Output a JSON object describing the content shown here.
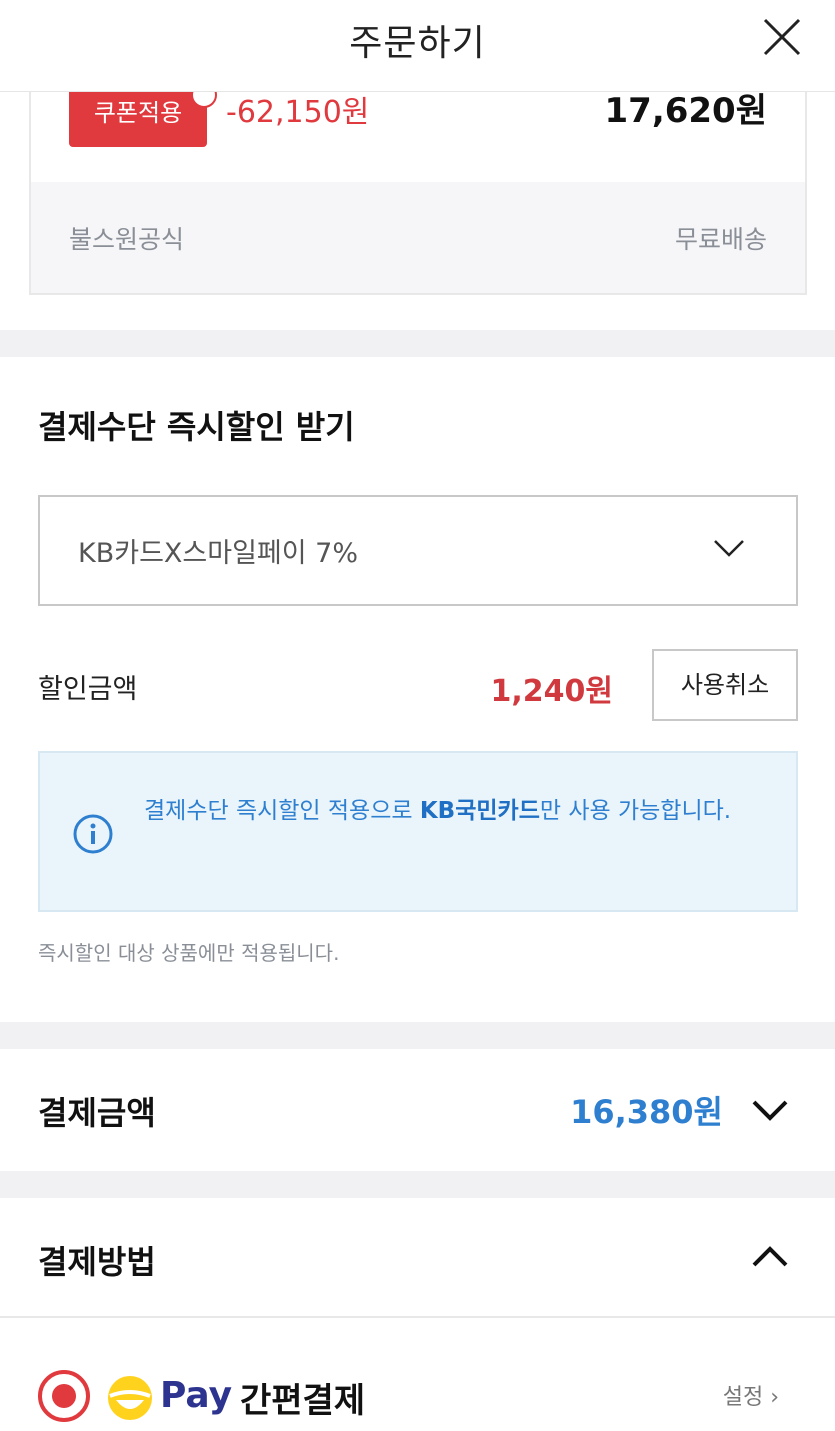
{
  "header": {
    "title": "주문하기"
  },
  "product": {
    "coupon_badge": "쿠폰적용",
    "coupon_discount": "-62,150원",
    "price": "17,620원",
    "seller": "불스원공식",
    "shipping": "무료배송"
  },
  "instant_discount": {
    "title": "결제수단 즉시할인 받기",
    "selected_card": "KB카드X스마일페이 7%",
    "discount_label": "할인금액",
    "discount_amount": "1,240원",
    "cancel_label": "사용취소",
    "info_prefix": "결제수단 즉시할인 적용으로 ",
    "info_highlight": "KB국민카드",
    "info_suffix": "만 사용 가능합니다.",
    "note": "즉시할인 대상 상품에만 적용됩니다."
  },
  "payment_total": {
    "label": "결제금액",
    "amount": "16,380원"
  },
  "payment_method": {
    "title": "결제방법",
    "option_logo_text": "Pay",
    "option_label": "간편결제",
    "settings_label": "설정 ›"
  },
  "colors": {
    "accent_red": "#e0393e",
    "accent_blue": "#2e7fd0",
    "info_bg": "#eaf5fb"
  }
}
